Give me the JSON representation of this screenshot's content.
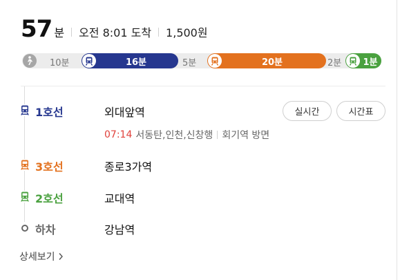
{
  "summary": {
    "total_minutes": "57",
    "minutes_unit": "분",
    "arrival": "오전 8:01 도착",
    "fare": "1,500원"
  },
  "segments": {
    "walk_time": "10분",
    "line1_time": "16분",
    "transfer1_time": "5분",
    "line3_time": "20분",
    "transfer2_time": "2분",
    "line2_time": "1분"
  },
  "colors": {
    "line1": "#26378f",
    "line3": "#e3711e",
    "line2": "#4aa13f",
    "departure_time": "#e0413b"
  },
  "steps": [
    {
      "label": "1호선",
      "station": "외대앞역",
      "icon": "subway-icon",
      "departure_time": "07:14",
      "direction": "서동탄,인천,신창행",
      "platform": "회기역 방면",
      "buttons": [
        "실시간",
        "시간표"
      ]
    },
    {
      "label": "3호선",
      "station": "종로3가역",
      "icon": "subway-icon"
    },
    {
      "label": "2호선",
      "station": "교대역",
      "icon": "subway-icon"
    },
    {
      "label": "하차",
      "station": "강남역",
      "icon": "circle-icon"
    }
  ],
  "detail_link": "상세보기",
  "detail_icon": "chevron-right-icon"
}
